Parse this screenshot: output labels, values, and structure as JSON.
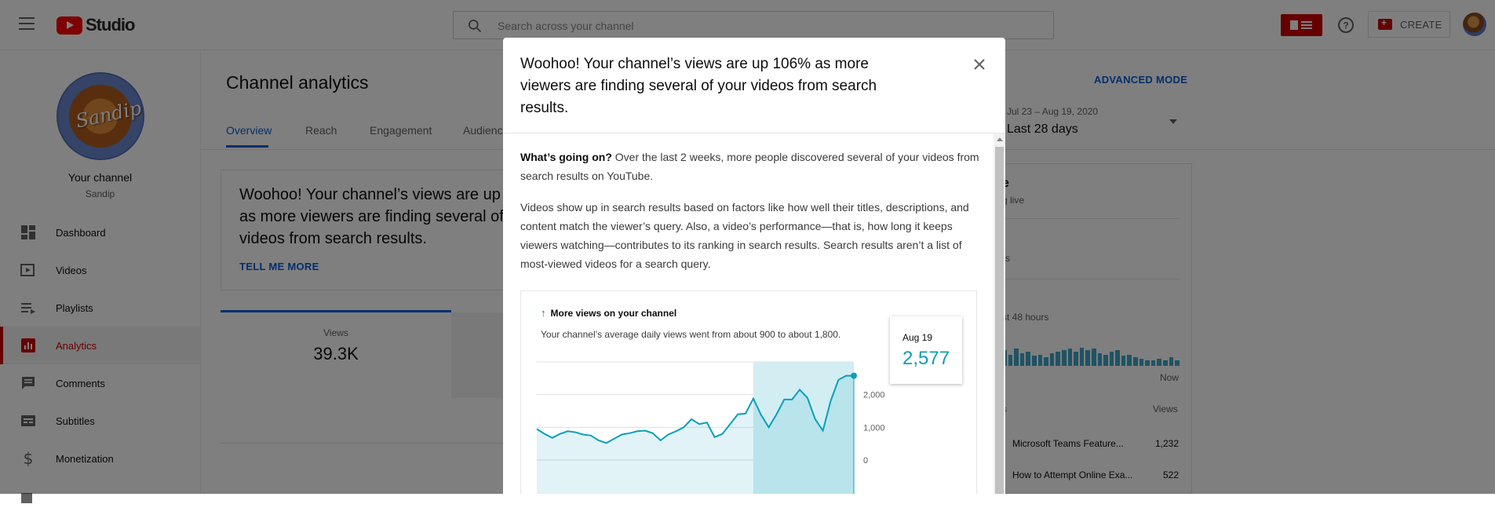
{
  "header": {
    "logo_text": "Studio",
    "search_placeholder": "Search across your channel",
    "create_label": "CREATE"
  },
  "sidebar": {
    "channel_title": "Your channel",
    "channel_name": "Sandip",
    "avatar_signature": "Sandip",
    "items": [
      {
        "label": "Dashboard",
        "icon": "dashboard-icon"
      },
      {
        "label": "Videos",
        "icon": "videos-icon"
      },
      {
        "label": "Playlists",
        "icon": "playlists-icon"
      },
      {
        "label": "Analytics",
        "icon": "analytics-icon",
        "active": true
      },
      {
        "label": "Comments",
        "icon": "comments-icon"
      },
      {
        "label": "Subtitles",
        "icon": "subtitles-icon"
      },
      {
        "label": "Monetization",
        "icon": "monetization-icon"
      }
    ]
  },
  "main": {
    "title": "Channel analytics",
    "advanced_mode": "ADVANCED MODE",
    "tabs": [
      "Overview",
      "Reach",
      "Engagement",
      "Audienc"
    ],
    "date_range": "Jul 23 – Aug 19, 2020",
    "date_label": "Last 28 days",
    "insight": {
      "headline": "Woohoo! Your channel’s views are up 106% as more viewers are finding several of your videos from search results.",
      "link": "TELL ME MORE"
    },
    "metric": {
      "label": "Views",
      "value": "39.3K"
    },
    "right_card": {
      "title": "e",
      "subtitle": "g live",
      "line1": "rs",
      "line2": "st 48 hours",
      "now_label": "Now",
      "col_header_left": "s",
      "col_header_right": "Views",
      "videos": [
        {
          "title": "Microsoft Teams Feature...",
          "views": "1,232"
        },
        {
          "title": "How to Attempt Online Exa...",
          "views": "522"
        }
      ]
    }
  },
  "modal": {
    "title": "Woohoo! Your channel’s views are up 106% as more viewers are finding several of your videos from search results.",
    "body_lead": "What’s going on?",
    "body_p1": " Over the last 2 weeks, more people discovered several of your videos from search results on YouTube.",
    "body_p2": "Videos show up in search results based on factors like how well their titles, descriptions, and content match the viewer’s query. Also, a video’s performance—that is, how long it keeps viewers watching—contributes to its ranking in search results. Search results aren’t a list of most-viewed videos for a search query.",
    "chart_heading": "More views on your channel",
    "chart_desc": "Your channel’s average daily views went from about 900 to about 1,800.",
    "tooltip_date": "Aug 19",
    "tooltip_value": "2,577"
  },
  "chart_data": {
    "type": "line",
    "title": "More views on your channel",
    "y_ticks": [
      "2,000",
      "1,000",
      "0"
    ],
    "ylim": [
      0,
      3000
    ],
    "highlight_last_n": 14,
    "values": [
      950,
      800,
      680,
      800,
      880,
      850,
      780,
      750,
      600,
      520,
      650,
      780,
      820,
      880,
      900,
      820,
      600,
      780,
      880,
      1000,
      1250,
      1100,
      1150,
      700,
      800,
      1100,
      1400,
      1420,
      1880,
      1380,
      1000,
      1400,
      1850,
      1850,
      2150,
      1900,
      1250,
      900,
      1800,
      2450,
      2577,
      2577
    ],
    "color": "#0b9fb8"
  }
}
